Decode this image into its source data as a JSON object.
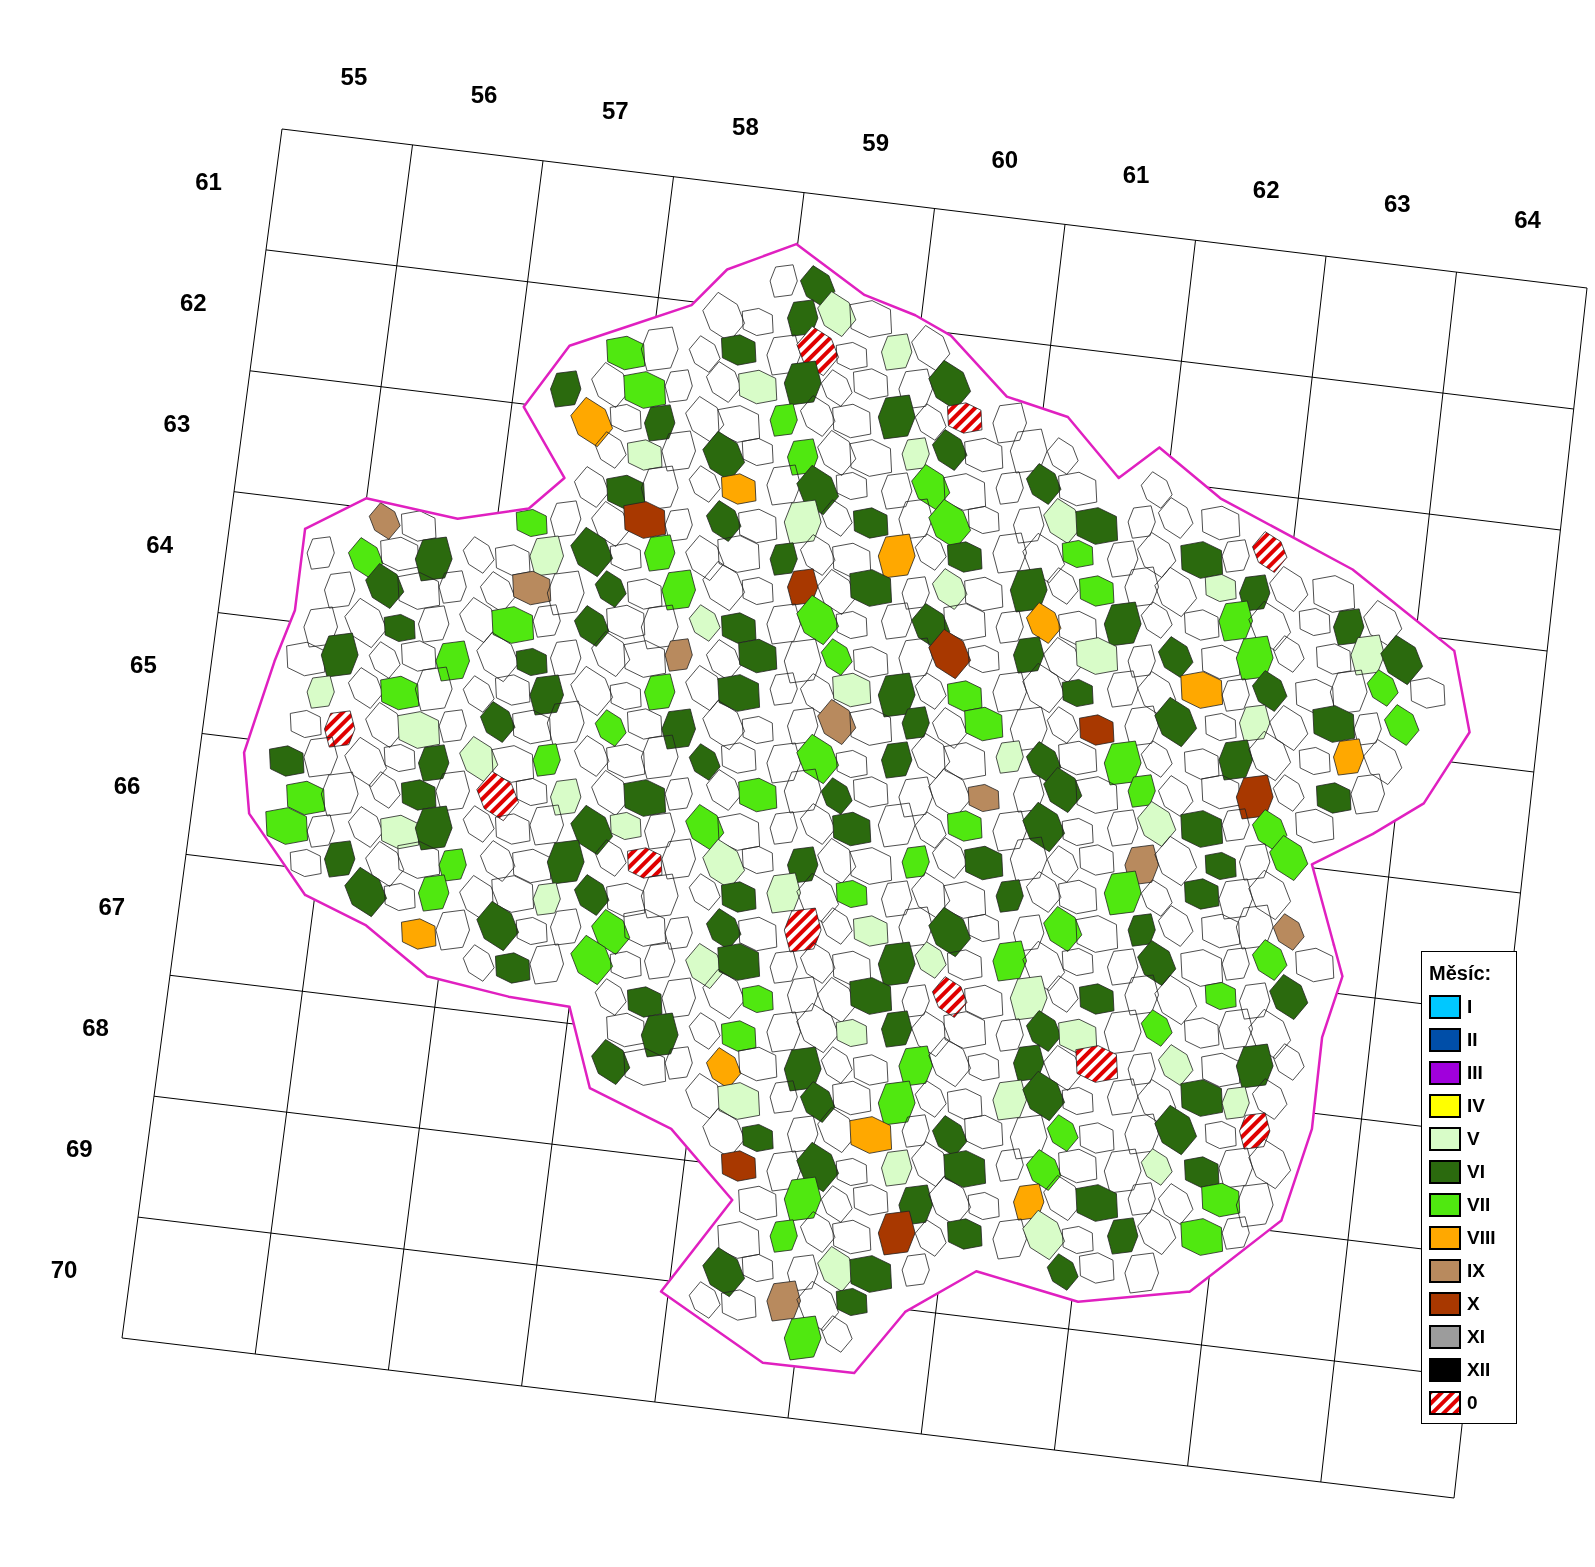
{
  "grid": {
    "column_labels": [
      "55",
      "56",
      "57",
      "58",
      "59",
      "60",
      "61",
      "62",
      "63",
      "64"
    ],
    "row_labels": [
      "61",
      "62",
      "63",
      "64",
      "65",
      "66",
      "67",
      "68",
      "69",
      "70"
    ]
  },
  "legend": {
    "title": "Měsíc:",
    "items": [
      {
        "label": "I",
        "kind": "solid",
        "color": "#00c8ff"
      },
      {
        "label": "II",
        "kind": "solid",
        "color": "#004ea8"
      },
      {
        "label": "III",
        "kind": "solid",
        "color": "#a000dc"
      },
      {
        "label": "IV",
        "kind": "solid",
        "color": "#ffff00"
      },
      {
        "label": "V",
        "kind": "solid",
        "color": "#d8fcc8"
      },
      {
        "label": "VI",
        "kind": "solid",
        "color": "#2b6a0e"
      },
      {
        "label": "VII",
        "kind": "solid",
        "color": "#50e810"
      },
      {
        "label": "VIII",
        "kind": "solid",
        "color": "#ffa800"
      },
      {
        "label": "IX",
        "kind": "solid",
        "color": "#b88a5e"
      },
      {
        "label": "X",
        "kind": "solid",
        "color": "#a83800"
      },
      {
        "label": "XI",
        "kind": "solid",
        "color": "#9c9c9c"
      },
      {
        "label": "XII",
        "kind": "solid",
        "color": "#000000"
      },
      {
        "label": "0",
        "kind": "hatched",
        "color": "#e00000"
      }
    ]
  }
}
